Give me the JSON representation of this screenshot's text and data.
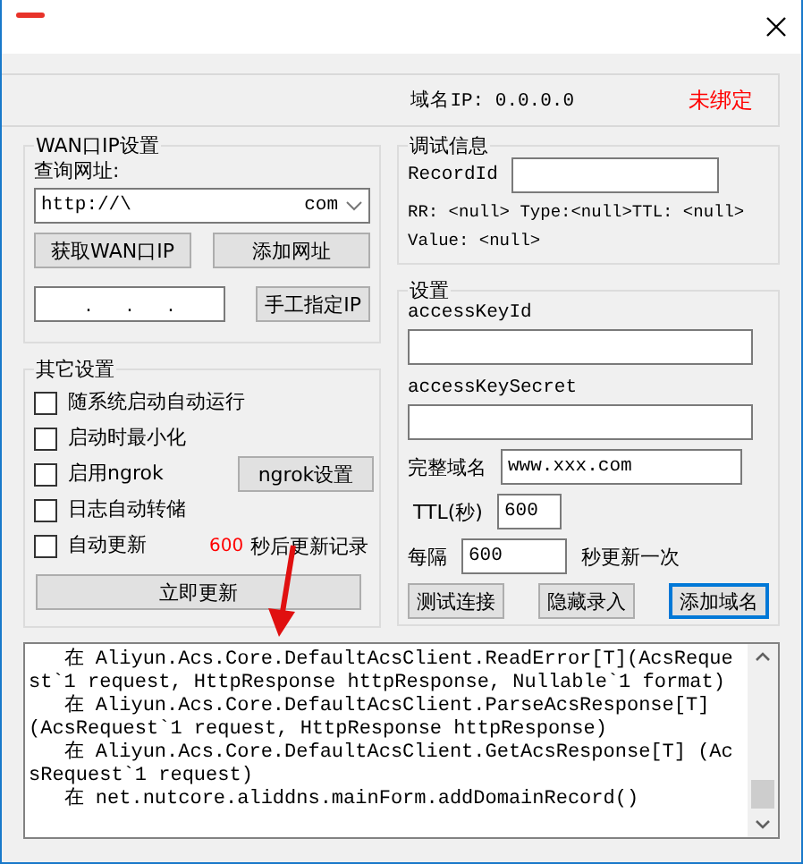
{
  "status": {
    "domain_ip": "域名IP: 0.0.0.0",
    "binding_status": "未绑定"
  },
  "wan_group": {
    "title": "WAN口IP设置",
    "query_label": "查询网址:",
    "url_combo": {
      "value": "http://\\",
      "suffix": "com"
    },
    "buttons": [
      "获取WAN口IP",
      "添加网址"
    ],
    "ip_field": {
      "separators": [
        ".",
        ".",
        "."
      ]
    },
    "manual_button": "手工指定IP"
  },
  "debug_group": {
    "title": "调试信息",
    "record_id_label": "RecordId",
    "info_lines": [
      "RR: <null> Type:<null>TTL: <null>",
      "Value: <null>"
    ]
  },
  "settings_group": {
    "title": "设置",
    "access_key_id_label": "accessKeyId",
    "access_key_secret_label": "accessKeySecret",
    "domain_label": "完整域名",
    "domain_value": "www.xxx.com",
    "ttl_label": "TTL(秒)",
    "ttl_value": "600",
    "interval_label": "每隔",
    "interval_value": "600",
    "interval_suffix": "秒更新一次",
    "buttons": [
      {
        "label": "测试连接",
        "focused": false
      },
      {
        "label": "隐藏录入",
        "focused": false
      },
      {
        "label": "添加域名",
        "focused": true
      }
    ]
  },
  "other_group": {
    "title": "其它设置",
    "options": [
      {
        "label": "随系统启动自动运行",
        "checked": false
      },
      {
        "label": "启动时最小化",
        "checked": false
      },
      {
        "label": "启用ngrok",
        "checked": false
      },
      {
        "label": "日志自动转储",
        "checked": false
      },
      {
        "label": "自动更新",
        "checked": false
      }
    ],
    "ngrok_button": "ngrok设置",
    "countdown": "600",
    "countdown_suffix": "秒后更新记录",
    "update_button": "立即更新"
  },
  "log": {
    "lines": [
      "   在 Aliyun.Acs.Core.DefaultAcsClient.ReadError[T](AcsRequest`1 request, HttpResponse httpResponse, Nullable`1 format)",
      "   在 Aliyun.Acs.Core.DefaultAcsClient.ParseAcsResponse[T] (AcsRequest`1 request, HttpResponse httpResponse)",
      "   在 Aliyun.Acs.Core.DefaultAcsClient.GetAcsResponse[T] (AcsRequest`1 request)",
      "   在 net.nutcore.aliddns.mainForm.addDomainRecord()"
    ]
  }
}
